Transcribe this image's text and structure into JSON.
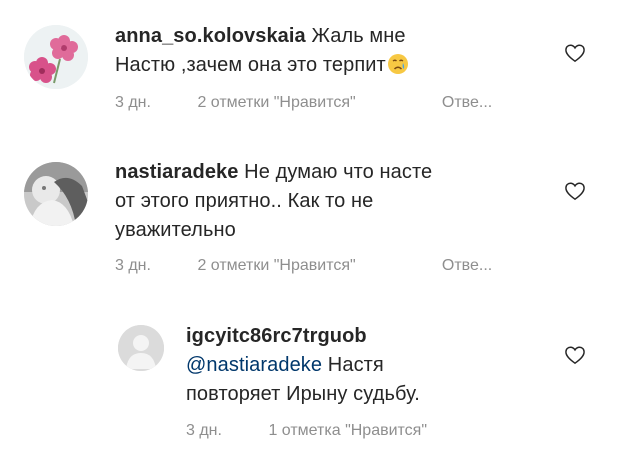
{
  "comments": [
    {
      "username": "anna_so.kolovskaia",
      "text_line1": "Жаль мне",
      "text_line2": "Настю ,зачем она это терпит",
      "emoji": "crying-face",
      "time": "3 дн.",
      "likes": "2 отметки \"Нравится\"",
      "reply": "Отве..."
    },
    {
      "username": "nastiaradeke",
      "text_line1": "Не думаю что насте",
      "text_line2": "от этого приятно.. Как то не",
      "text_line3": "уважительно",
      "time": "3 дн.",
      "likes": "2 отметки \"Нравится\"",
      "reply": "Отве..."
    },
    {
      "username": "igcyitc86rc7trguob",
      "mention": "@nastiaradeke",
      "text_line1": "Настя",
      "text_line2": "повторяет Ирыну судьбу.",
      "time": "3 дн.",
      "likes": "1 отметка \"Нравится\""
    }
  ],
  "colors": {
    "text": "#262626",
    "meta": "#8e8e8e",
    "mention": "#00376b",
    "avatar_placeholder": "#e8e8e8"
  }
}
